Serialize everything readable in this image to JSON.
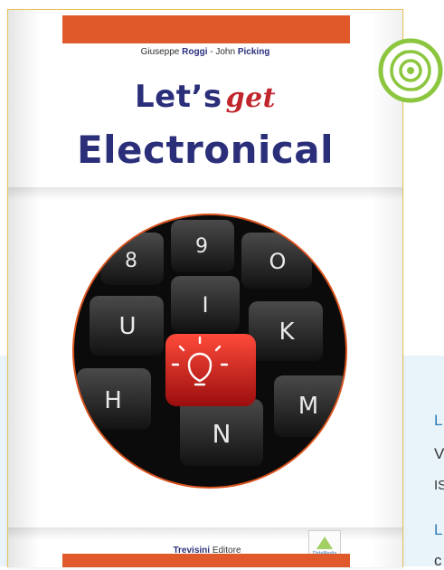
{
  "cover": {
    "author1_first": "Giuseppe",
    "author1_last": "Roggi",
    "separator": " - ",
    "author2_first": "John",
    "author2_last": "Picking",
    "title_part1": "Let’s",
    "title_part2": "get",
    "title_line2": "Electronical",
    "publisher_name": "Trevisini",
    "publisher_suffix": "Editore",
    "logo_text": "DidaMedia"
  },
  "keyboard_keys": [
    "8",
    "9",
    "O",
    "I",
    "U",
    "K",
    "H",
    "N",
    "M"
  ],
  "side_text": {
    "line1": "L",
    "line2": "V",
    "line3": "IS",
    "line4": "L",
    "line5": "c"
  },
  "colors": {
    "stripe": "#e0592a",
    "title_blue": "#2b2f7a",
    "title_red": "#c0262c",
    "cd_green": "#8cc63f",
    "band": "#e8f3fa",
    "side_link": "#2b7bb9"
  },
  "icons": {
    "cd": "cd-disc-icon",
    "bulb": "lightbulb-icon"
  }
}
